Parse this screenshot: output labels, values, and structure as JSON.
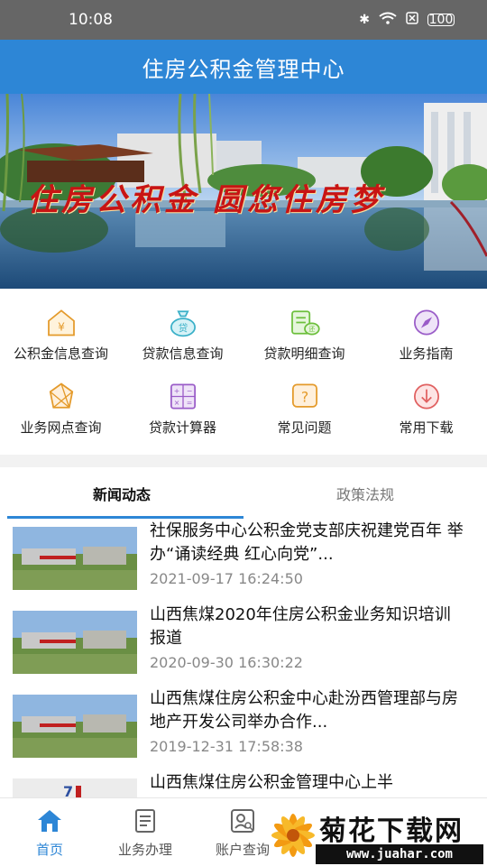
{
  "status_bar": {
    "time": "10:08",
    "battery": "100"
  },
  "header": {
    "title": "住房公积金管理中心"
  },
  "banner": {
    "slogan": "住房公积金 圆您住房梦"
  },
  "menu": {
    "items": [
      {
        "label": "公积金信息查询",
        "icon": "house-yuan-icon"
      },
      {
        "label": "贷款信息查询",
        "icon": "loan-bag-icon"
      },
      {
        "label": "贷款明细查询",
        "icon": "loan-detail-icon"
      },
      {
        "label": "业务指南",
        "icon": "compass-icon"
      },
      {
        "label": "业务网点查询",
        "icon": "network-icon"
      },
      {
        "label": "贷款计算器",
        "icon": "calculator-icon"
      },
      {
        "label": "常见问题",
        "icon": "question-icon"
      },
      {
        "label": "常用下载",
        "icon": "download-icon"
      }
    ]
  },
  "news": {
    "tabs": [
      {
        "label": "新闻动态"
      },
      {
        "label": "政策法规"
      }
    ],
    "items": [
      {
        "title": "社保服务中心公积金党支部庆祝建党百年 举办“诵读经典 红心向党”...",
        "date": "2021-09-17 16:24:50"
      },
      {
        "title": "山西焦煤2020年住房公积金业务知识培训报道",
        "date": "2020-09-30 16:30:22"
      },
      {
        "title": "山西焦煤住房公积金中心赴汾西管理部与房地产开发公司举办合作...",
        "date": "2019-12-31 17:58:38"
      },
      {
        "title": "山西焦煤住房公积金管理中心上半",
        "date": ""
      }
    ]
  },
  "bottom_nav": {
    "items": [
      {
        "label": "首页",
        "icon": "home-icon"
      },
      {
        "label": "业务办理",
        "icon": "document-icon"
      },
      {
        "label": "账户查询",
        "icon": "account-search-icon"
      }
    ]
  },
  "watermark": {
    "title": "菊花下载网",
    "url": "www.juahar.com"
  },
  "colors": {
    "primary": "#2d86d6",
    "status_bar": "#666666",
    "slogan": "#c81414"
  }
}
